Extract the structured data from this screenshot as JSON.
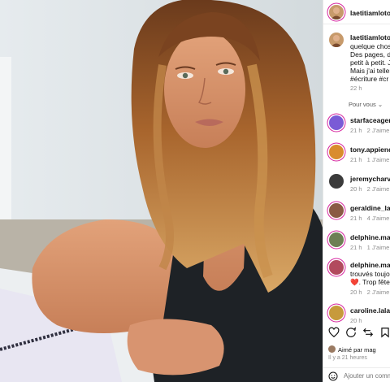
{
  "post": {
    "author": "laetitiamlotoforiginal",
    "caption_lines": [
      "quelque chos",
      "Des pages, d",
      "petit à petit. J",
      "Mais j'ai tellem",
      "#écriture #cr"
    ],
    "caption_author": "laetitiamlotof",
    "caption_time": "22 h"
  },
  "comments_filter": "Pour vous ⌄",
  "comments": [
    {
      "user": "starfaceagency",
      "time": "21 h",
      "likes": "2 J'aime",
      "avatar_color": "#7a5bd6"
    },
    {
      "user": "tony.appiendi",
      "time": "21 h",
      "likes": "1 J'aime",
      "avatar_color": "#d98c2e"
    },
    {
      "user": "jeremycharvet",
      "time": "20 h",
      "likes": "2 J'aime",
      "avatar_color": "#3b3b3b"
    },
    {
      "user": "geraldine_lapo",
      "time": "21 h",
      "likes": "4 J'aime",
      "avatar_color": "#8a5a44"
    },
    {
      "user": "delphine.marc",
      "time": "21 h",
      "likes": "1 J'aime",
      "avatar_color": "#6d7f54"
    },
    {
      "user": "delphine.marc",
      "time": "20 h",
      "likes": "2 J'aime",
      "avatar_color": "#b24a5e"
    },
    {
      "user": "caroline.lalan",
      "time": "20 h",
      "likes": "",
      "avatar_color": "#c79a3c"
    }
  ],
  "comment_extra_lines": [
    "trouvés toujo",
    "❤️. Trop fête"
  ],
  "liked_by": "Aimé par mag",
  "time_ago": "Il y a 21 heures",
  "add_comment_placeholder": "Ajouter un comm",
  "colors": {
    "ring": "#d6249f",
    "link": "#00376b",
    "meta": "#8e8e8e"
  },
  "icons": [
    "heart-icon",
    "comment-icon",
    "share-icon",
    "save-icon",
    "emoji-icon"
  ]
}
